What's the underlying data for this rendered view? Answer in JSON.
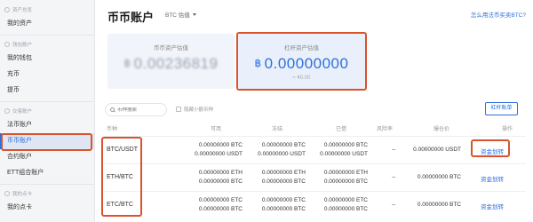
{
  "sidebar": {
    "sections": [
      {
        "title": "资产总览",
        "items": [
          {
            "label": "我的资产"
          }
        ]
      },
      {
        "title": "钱包账户",
        "items": [
          {
            "label": "我的钱包"
          },
          {
            "label": "充币"
          },
          {
            "label": "提币"
          }
        ]
      },
      {
        "title": "交易账户",
        "items": [
          {
            "label": "法币账户"
          },
          {
            "label": "币币账户"
          },
          {
            "label": "合约账户"
          },
          {
            "label": "ETT组合账户"
          }
        ]
      },
      {
        "title": "我的点卡",
        "items": [
          {
            "label": "我的点卡"
          }
        ]
      }
    ],
    "active_item": "币币账户"
  },
  "header": {
    "title": "币币账户",
    "valuation_select": "BTC 估值",
    "help_link": "怎么用法币买卖BTC?"
  },
  "cards": [
    {
      "label": "币币资产估值",
      "currency_symbol": "฿",
      "value": "0.00236819",
      "sub": ""
    },
    {
      "label": "杠杆资产估值",
      "currency_symbol": "฿",
      "value": "0.00000000",
      "sub": "≈ ¥0.00"
    }
  ],
  "filters": {
    "search_placeholder": "币种搜索",
    "hide_small_label": "隐藏小额币种",
    "leverage_button": "杠杆账单"
  },
  "table": {
    "headers": [
      "币种",
      "可用",
      "冻结",
      "已借",
      "风险率",
      "爆仓价",
      "操作"
    ],
    "rows": [
      {
        "pair": "BTC/USDT",
        "available": [
          "0.00000000 BTC",
          "0.00000000 USDT"
        ],
        "frozen": [
          "0.00000000 BTC",
          "0.00000000 USDT"
        ],
        "borrowed": [
          "0.00000000 BTC",
          "0.00000000 USDT"
        ],
        "risk": "--",
        "liquidation": "0.00000000 USDT",
        "action": "资金划转"
      },
      {
        "pair": "ETH/BTC",
        "available": [
          "0.00000000 ETH",
          "0.00000000 BTC"
        ],
        "frozen": [
          "0.00000000 ETH",
          "0.00000000 BTC"
        ],
        "borrowed": [
          "0.00000000 ETH",
          "0.00000000 BTC"
        ],
        "risk": "--",
        "liquidation": "0.00000000 BTC",
        "action": "资金划转"
      },
      {
        "pair": "ETC/BTC",
        "available": [
          "0.00000000 ETC",
          "0.00000000 BTC"
        ],
        "frozen": [
          "0.00000000 ETC",
          "0.00000000 BTC"
        ],
        "borrowed": [
          "0.00000000 ETC",
          "0.00000000 BTC"
        ],
        "risk": "--",
        "liquidation": "0.00000000 BTC",
        "action": "资金划转"
      }
    ]
  },
  "colors": {
    "accent": "#2c6fdd",
    "highlight": "#d9532c"
  }
}
